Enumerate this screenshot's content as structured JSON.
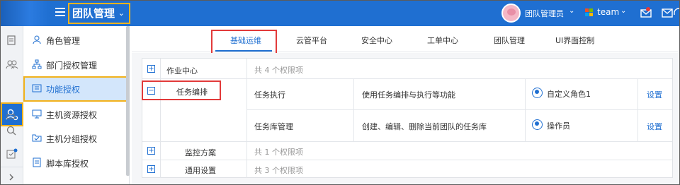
{
  "header": {
    "module_title": "团队管理",
    "user_name": "团队管理员",
    "team_name": "team",
    "colors": {
      "primary": "#1f6fd1",
      "highlight": "#f2b21c",
      "annotation": "#e23a3a"
    }
  },
  "rail": {
    "icons": [
      "document-icon",
      "group-icon",
      "user-settings-icon",
      "key-icon",
      "search-icon",
      "checklist-icon",
      "expand-icon"
    ]
  },
  "sidebar": {
    "items": [
      {
        "label": "角色管理",
        "icon": "role-icon"
      },
      {
        "label": "部门授权管理",
        "icon": "org-chart-icon"
      },
      {
        "label": "功能授权",
        "icon": "feature-auth-icon",
        "active": true
      },
      {
        "label": "主机资源授权",
        "icon": "monitor-icon"
      },
      {
        "label": "主机分组授权",
        "icon": "folder-icon"
      },
      {
        "label": "脚本库授权",
        "icon": "script-icon"
      }
    ]
  },
  "tabs": [
    {
      "label": "基础运维",
      "active": true
    },
    {
      "label": "云管平台"
    },
    {
      "label": "安全中心"
    },
    {
      "label": "工单中心"
    },
    {
      "label": "团队管理"
    },
    {
      "label": "UI界面控制"
    }
  ],
  "permissions": {
    "groups": [
      {
        "name": "作业中心",
        "expander": "+",
        "count_text": "共 4 个权限项"
      },
      {
        "name": "任务编排",
        "expander": "−",
        "items": [
          {
            "name": "任务执行",
            "description": "使用任务编排与执行等功能",
            "role": "自定义角色1",
            "action": "设置"
          },
          {
            "name": "任务库管理",
            "description": "创建、编辑、删除当前团队的任务库",
            "role": "操作员",
            "action": "设置"
          }
        ]
      },
      {
        "name": "监控方案",
        "expander": "+",
        "count_text": "共 1 个权限项"
      },
      {
        "name": "通用设置",
        "expander": "+",
        "count_text": "共 3 个权限项"
      }
    ]
  }
}
